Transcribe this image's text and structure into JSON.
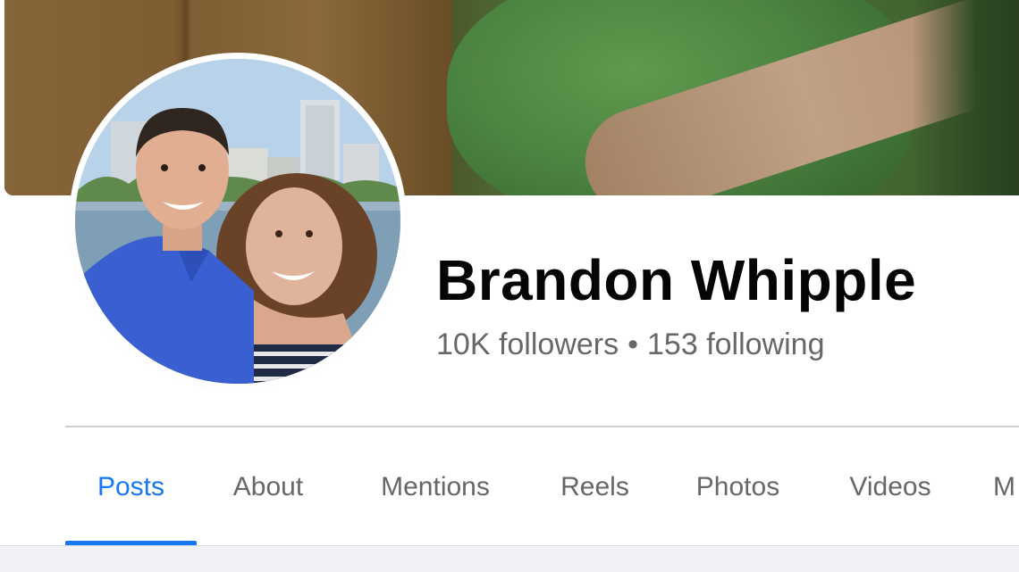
{
  "profile": {
    "name": "Brandon Whipple",
    "followers": "10K followers",
    "separator": "•",
    "following": "153 following"
  },
  "tabs": [
    {
      "label": "Posts",
      "active": true
    },
    {
      "label": "About",
      "active": false
    },
    {
      "label": "Mentions",
      "active": false
    },
    {
      "label": "Reels",
      "active": false
    },
    {
      "label": "Photos",
      "active": false
    },
    {
      "label": "Videos",
      "active": false
    },
    {
      "label": "M",
      "active": false
    }
  ],
  "colors": {
    "accent": "#1877f2",
    "name_text": "#050505",
    "secondary_text": "#65676b",
    "divider": "#ced0d4",
    "page_band": "#f0f2f5"
  }
}
